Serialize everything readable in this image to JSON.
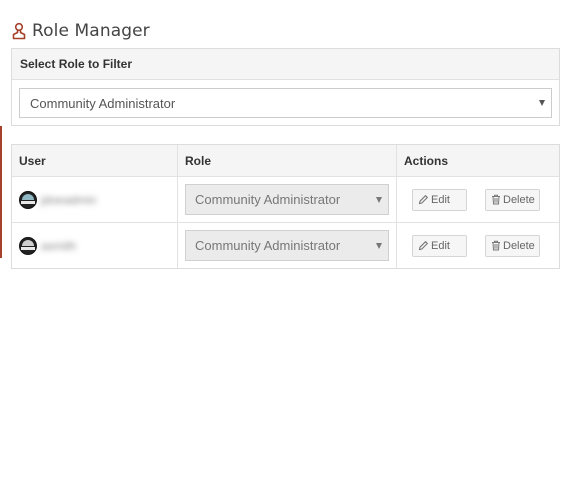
{
  "header": {
    "title": "Role Manager",
    "icon": "user-icon"
  },
  "filter": {
    "panel_title": "Select Role to Filter",
    "selected": "Community Administrator"
  },
  "table": {
    "columns": [
      "User",
      "Role",
      "Actions"
    ],
    "rows": [
      {
        "user": "jdoeadmin",
        "role": "Community Administrator"
      },
      {
        "user": "asmith",
        "role": "Community Administrator"
      }
    ],
    "edit_label": "Edit",
    "delete_label": "Delete"
  },
  "colors": {
    "accent": "#a5412a",
    "panel_header_bg": "#f5f5f5",
    "border": "#dcdcdc"
  }
}
